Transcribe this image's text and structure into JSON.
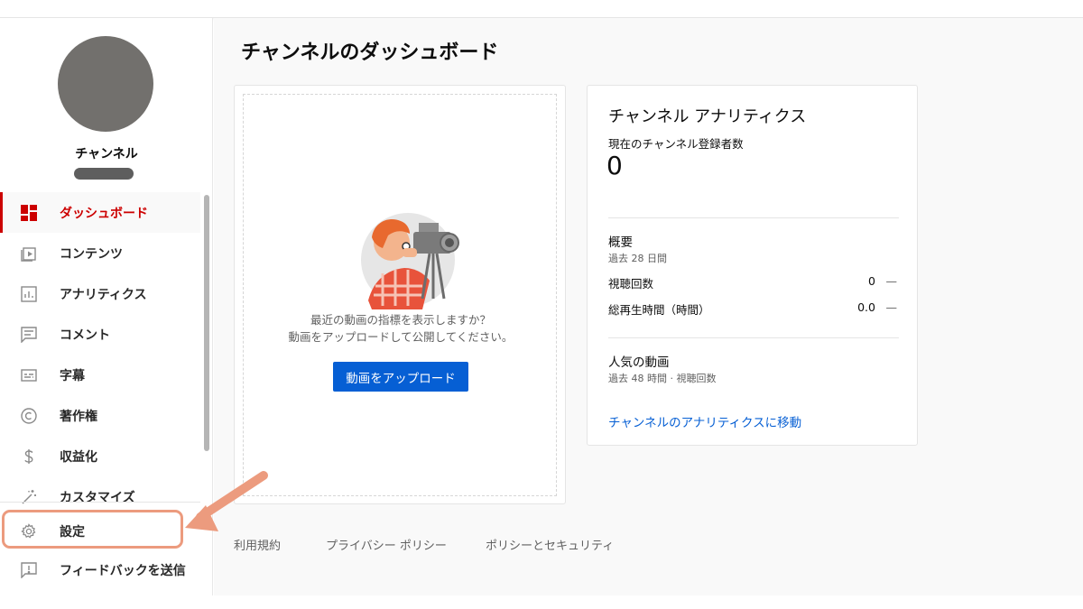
{
  "channel": {
    "name": "チャンネル"
  },
  "sidebar": {
    "items": [
      {
        "label": "ダッシュボード",
        "icon": "dashboard-icon",
        "active": true
      },
      {
        "label": "コンテンツ",
        "icon": "content-icon"
      },
      {
        "label": "アナリティクス",
        "icon": "analytics-icon"
      },
      {
        "label": "コメント",
        "icon": "comment-icon"
      },
      {
        "label": "字幕",
        "icon": "subtitles-icon"
      },
      {
        "label": "著作権",
        "icon": "copyright-icon"
      },
      {
        "label": "収益化",
        "icon": "dollar-icon"
      },
      {
        "label": "カスタマイズ",
        "icon": "magic-wand-icon"
      }
    ],
    "settings": {
      "label": "設定",
      "icon": "gear-icon"
    },
    "feedback": {
      "label": "フィードバックを送信",
      "icon": "feedback-icon"
    }
  },
  "main": {
    "title": "チャンネルのダッシュボード"
  },
  "upload_card": {
    "text_line1": "最近の動画の指標を表示しますか？",
    "text_line2": "動画をアップロードして公開してください。",
    "button_label": "動画をアップロード"
  },
  "analytics": {
    "title": "チャンネル アナリティクス",
    "subscribers_label": "現在のチャンネル登録者数",
    "subscribers_count": "0",
    "summary_title": "概要",
    "summary_period": "過去 28 日間",
    "rows": [
      {
        "label": "視聴回数",
        "value": "0",
        "trend": "—"
      },
      {
        "label": "総再生時間（時間）",
        "value": "0.0",
        "trend": "—"
      }
    ],
    "popular_title": "人気の動画",
    "popular_period": "過去 48 時間 · 視聴回数",
    "link_label": "チャンネルのアナリティクスに移動"
  },
  "footer": {
    "terms": "利用規約",
    "privacy": "プライバシー ポリシー",
    "policy_security": "ポリシーとセキュリティ"
  },
  "colors": {
    "accent_red": "#cc0000",
    "primary_blue": "#065fd4",
    "annotation": "#ec9b7e"
  }
}
